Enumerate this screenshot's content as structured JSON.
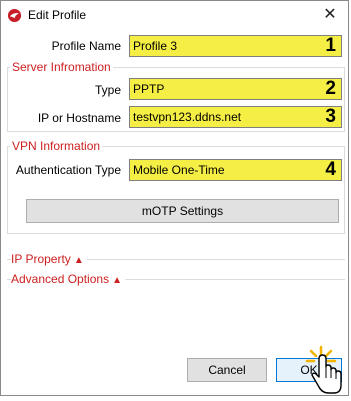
{
  "window": {
    "title": "Edit Profile",
    "close_symbol": "✕",
    "app_icon": "red-bird-icon"
  },
  "profile": {
    "label": "Profile Name",
    "value": "Profile 3",
    "marker": "1"
  },
  "server": {
    "legend": "Server Infromation",
    "type_label": "Type",
    "type_value": "PPTP",
    "type_marker": "2",
    "host_label": "IP or Hostname",
    "host_value": "testvpn123.ddns.net",
    "host_marker": "3"
  },
  "vpn": {
    "legend": "VPN Information",
    "auth_label": "Authentication Type",
    "auth_value": "Mobile One-Time",
    "auth_marker": "4",
    "motp_button": "mOTP Settings"
  },
  "sections": {
    "ip_property": "IP Property",
    "advanced_options": "Advanced Options",
    "expand_symbol": "▲"
  },
  "buttons": {
    "cancel": "Cancel",
    "ok": "OK"
  },
  "colors": {
    "highlight": "#f5ee44",
    "section_red": "#cc1f1f"
  },
  "icons": [
    "red-bird-icon",
    "close-icon",
    "expand-triangle-icon",
    "hand-pointer-icon"
  ]
}
